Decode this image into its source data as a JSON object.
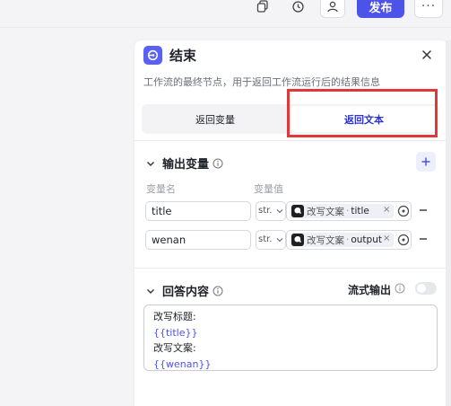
{
  "toolbar": {
    "publish_label": "发布",
    "more_label": "···",
    "icons": [
      "copy-icon",
      "history-icon",
      "user-icon"
    ]
  },
  "panel": {
    "title": "结束",
    "description": "工作流的最终节点，用于返回工作流运行后的结果信息",
    "close_icon": "close-icon"
  },
  "tabs": [
    {
      "label": "返回变量",
      "active": false
    },
    {
      "label": "返回文本",
      "active": true
    }
  ],
  "output_section": {
    "title": "输出变量",
    "col_name": "变量名",
    "col_value": "变量值",
    "rows": [
      {
        "name": "title",
        "type": "str.",
        "ref_node": "改写文案",
        "ref_var": "title"
      },
      {
        "name": "wenan",
        "type": "str.",
        "ref_node": "改写文案",
        "ref_var": "output"
      }
    ]
  },
  "answer_section": {
    "title": "回答内容",
    "stream_label": "流式输出",
    "stream_enabled": false,
    "lines": [
      {
        "text": "改写标题:",
        "kind": "plain"
      },
      {
        "text": "{{title}}",
        "kind": "var"
      },
      {
        "text": "改写文案:",
        "kind": "plain"
      },
      {
        "text": "{{wenan}}",
        "kind": "var"
      }
    ]
  },
  "colors": {
    "accent": "#4d53e8",
    "highlight_box": "#e03838"
  }
}
